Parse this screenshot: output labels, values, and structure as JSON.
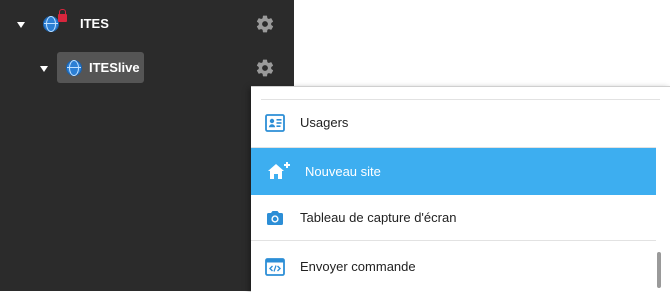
{
  "tree": {
    "items": [
      {
        "label": "ITES",
        "icon": "globe-lock-icon",
        "expanded": true
      },
      {
        "label": "ITESlive",
        "icon": "globe-icon",
        "expanded": true,
        "selected": true
      }
    ]
  },
  "context_menu": {
    "items": [
      {
        "label": "Usagers",
        "icon": "contact-card-icon"
      },
      {
        "label": "Nouveau site",
        "icon": "house-plus-icon",
        "highlighted": true
      },
      {
        "label": "Tableau de capture d'écran",
        "icon": "camera-icon"
      },
      {
        "label": "Envoyer commande",
        "icon": "code-window-icon"
      }
    ]
  },
  "colors": {
    "sidebar_bg": "#2b2b2b",
    "selected_bg": "#555555",
    "highlight": "#3daef0",
    "icon_blue": "#2c7fd4"
  }
}
